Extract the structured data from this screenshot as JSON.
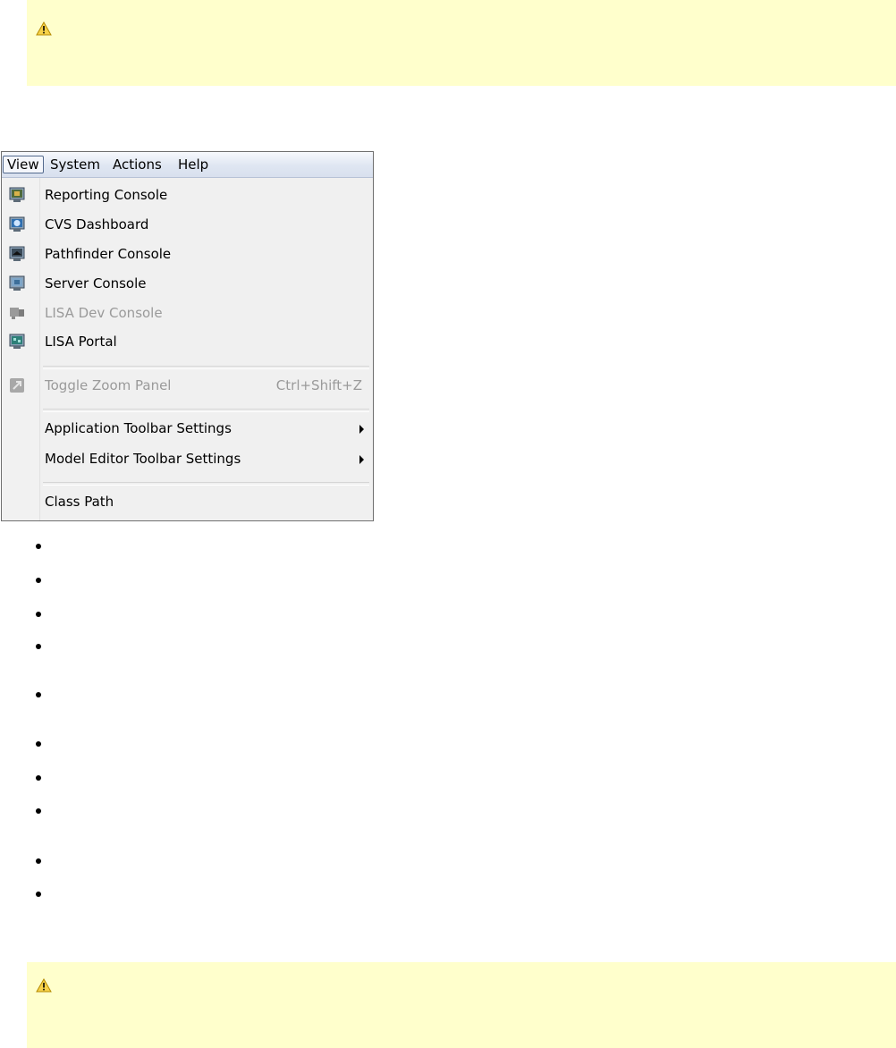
{
  "warnings": [
    {
      "icon": "warning-icon",
      "text": ""
    },
    {
      "icon": "warning-icon",
      "text": ""
    }
  ],
  "menubar": {
    "items": [
      "View",
      "System",
      "Actions",
      "Help"
    ],
    "active": "View"
  },
  "menu": {
    "items": [
      {
        "label": "Reporting Console",
        "icon": "reporting-console-icon",
        "enabled": true
      },
      {
        "label": "CVS Dashboard",
        "icon": "cvs-dashboard-icon",
        "enabled": true
      },
      {
        "label": "Pathfinder Console",
        "icon": "pathfinder-console-icon",
        "enabled": true
      },
      {
        "label": "Server Console",
        "icon": "server-console-icon",
        "enabled": true
      },
      {
        "label": "LISA Dev Console",
        "icon": "lisa-dev-console-icon",
        "enabled": false
      },
      {
        "label": "LISA Portal",
        "icon": "lisa-portal-icon",
        "enabled": true
      },
      {
        "label": "Toggle Zoom Panel",
        "icon": "zoom-panel-icon",
        "enabled": false,
        "shortcut": "Ctrl+Shift+Z"
      },
      {
        "label": "Application Toolbar Settings",
        "submenu": true,
        "enabled": true
      },
      {
        "label": "Model Editor Toolbar Settings",
        "submenu": true,
        "enabled": true
      },
      {
        "label": "Class Path",
        "enabled": true
      }
    ]
  },
  "bullet_count": 10,
  "colors": {
    "warning_bg": "#ffffcc",
    "menubar_border": "#546a8e",
    "disabled_text": "#9a9a9a"
  }
}
